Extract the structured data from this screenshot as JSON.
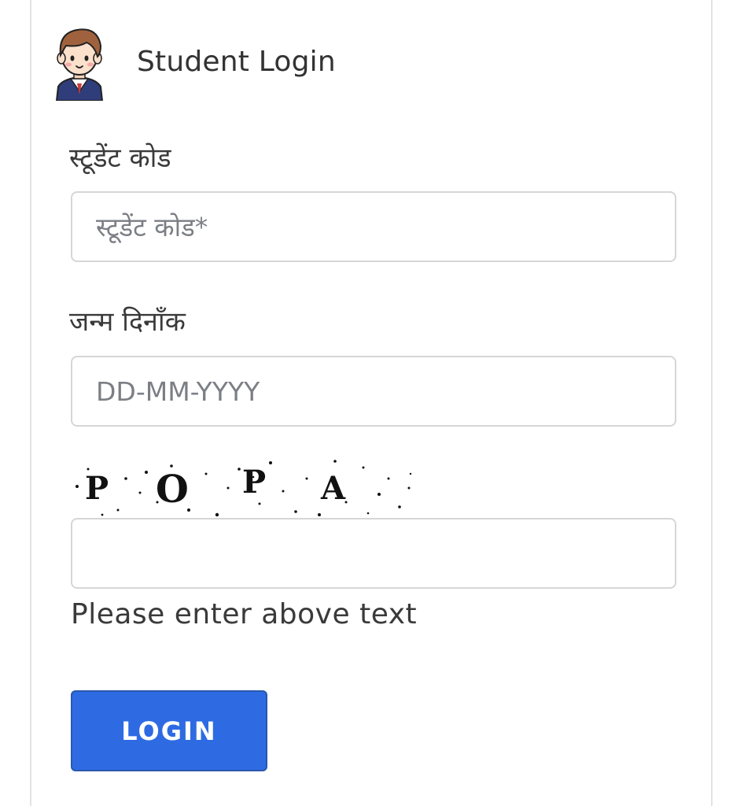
{
  "header": {
    "title": "Student Login",
    "avatar_icon": "student-avatar-icon"
  },
  "fields": {
    "student_code": {
      "label": "स्टूडेंट कोड",
      "placeholder": "स्टूडेंट कोड*",
      "value": ""
    },
    "dob": {
      "label": "जन्म दिनाँक",
      "placeholder": "DD-MM-YYYY",
      "value": ""
    },
    "captcha": {
      "text": "POPA",
      "value": "",
      "hint": "Please enter above text"
    }
  },
  "actions": {
    "login_label": "LOGIN"
  },
  "colors": {
    "primary": "#2e6be3",
    "input_border": "#d6d6d6",
    "text": "#333333"
  }
}
